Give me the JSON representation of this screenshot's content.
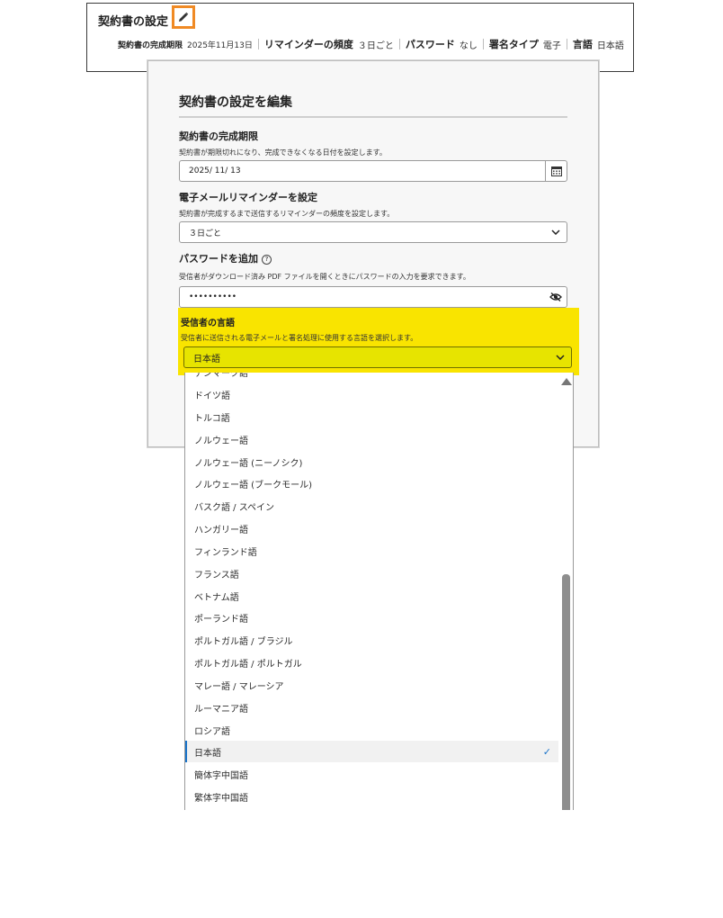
{
  "summary": {
    "title": "契約書の設定",
    "deadline_label": "契約書の完成期限",
    "deadline_value": "2025年11月13日",
    "reminder_label": "リマインダーの頻度",
    "reminder_value": "３日ごと",
    "password_label": "パスワード",
    "password_value": "なし",
    "signature_label": "署名タイプ",
    "signature_value": "電子",
    "language_label": "言語",
    "language_value": "日本語"
  },
  "modal": {
    "title": "契約書の設定を編集",
    "deadline": {
      "heading": "契約書の完成期限",
      "description": "契約書が期限切れになり、完成できなくなる日付を設定します。",
      "value": "2025/  11/  13"
    },
    "reminder": {
      "heading": "電子メールリマインダーを設定",
      "description": "契約書が完成するまで送信するリマインダーの頻度を設定します。",
      "value": "３日ごと"
    },
    "password": {
      "heading": "パスワードを追加",
      "description": "受信者がダウンロード済み PDF ファイルを開くときにパスワードの入力を要求できます。",
      "value": "••••••••••"
    },
    "language": {
      "heading": "受信者の言語",
      "description": "受信者に送信される電子メールと署名処理に使用する言語を選択します。",
      "value": "日本語"
    }
  },
  "dropdown": {
    "options": [
      "デンマーク語",
      "ドイツ語",
      "トルコ語",
      "ノルウェー語",
      "ノルウェー語 (ニーノシク)",
      "ノルウェー語 (ブークモール)",
      "バスク語 / スペイン",
      "ハンガリー語",
      "フィンランド語",
      "フランス語",
      "ベトナム語",
      "ポーランド語",
      "ポルトガル語 / ブラジル",
      "ポルトガル語 / ポルトガル",
      "マレー語 / マレーシア",
      "ルーマニア語",
      "ロシア語",
      "日本語",
      "簡体字中国語",
      "繁体字中国語"
    ],
    "selected": "日本語",
    "check": "✓"
  },
  "colors": {
    "accent": "#1a73c9",
    "highlight": "#f9e400",
    "edit_outline": "#f08a24"
  }
}
